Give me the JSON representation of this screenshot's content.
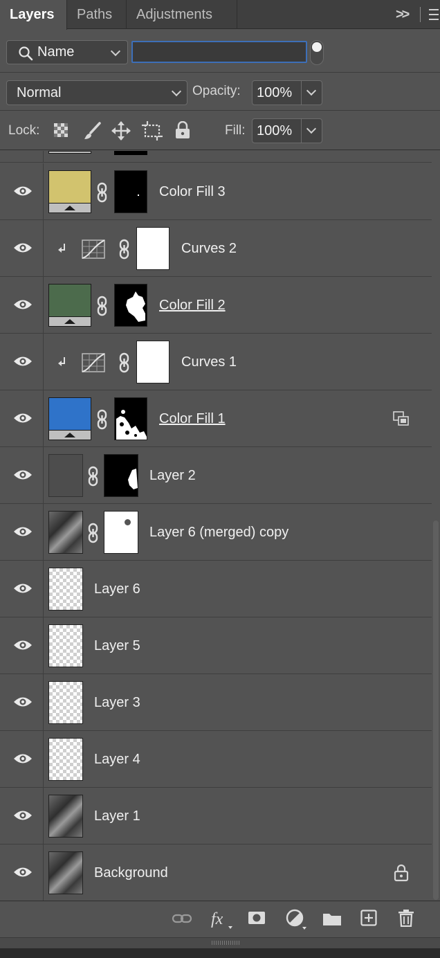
{
  "tabs": [
    {
      "label": "Layers",
      "active": true
    },
    {
      "label": "Paths",
      "active": false
    },
    {
      "label": "Adjustments",
      "active": false
    }
  ],
  "tab_menu": {
    "expand_label": ">>"
  },
  "filter": {
    "kind_label": "Name",
    "search_value": ""
  },
  "blend": {
    "mode": "Normal",
    "opacity_label": "Opacity:",
    "opacity_value": "100%"
  },
  "lock": {
    "label": "Lock:",
    "fill_label": "Fill:",
    "fill_value": "100%"
  },
  "layers": [
    {
      "name": "Color Fill 3",
      "type": "fill",
      "fill_color": "#d2c36e",
      "underlined": false
    },
    {
      "name": "Curves 2",
      "type": "curves",
      "clipped": true
    },
    {
      "name": "Color Fill 2",
      "type": "fill",
      "fill_color": "#4c6b4c",
      "underlined": true
    },
    {
      "name": "Curves 1",
      "type": "curves",
      "clipped": true
    },
    {
      "name": "Color Fill 1",
      "type": "fill",
      "fill_color": "#2f73c9",
      "underlined": true,
      "smart_badge": true
    },
    {
      "name": "Layer 2",
      "type": "masked"
    },
    {
      "name": "Layer 6 (merged) copy",
      "type": "photo-masked"
    },
    {
      "name": "Layer 6",
      "type": "transparent"
    },
    {
      "name": "Layer 5",
      "type": "transparent"
    },
    {
      "name": "Layer 3",
      "type": "transparent"
    },
    {
      "name": "Layer 4",
      "type": "transparent"
    },
    {
      "name": "Layer 1",
      "type": "photo"
    },
    {
      "name": "Background",
      "type": "photo",
      "locked": true
    }
  ],
  "colors": {
    "panel": "#535353",
    "tabbar": "#3f3f3f",
    "focus": "#3d6fb8"
  }
}
